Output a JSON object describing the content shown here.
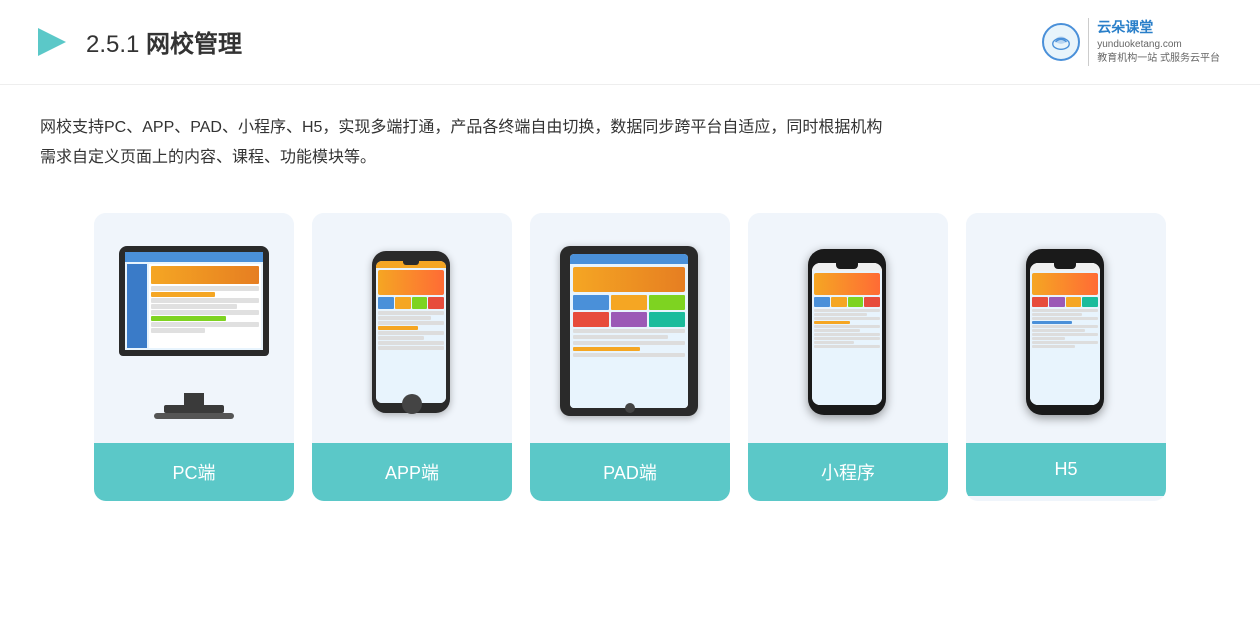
{
  "header": {
    "title_prefix": "2.5.1 ",
    "title_bold": "网校管理",
    "logo_brand": "云朵课堂",
    "logo_domain": "yunduoketang.com",
    "logo_tagline1": "教育机构一站",
    "logo_tagline2": "式服务云平台"
  },
  "description": {
    "line1": "网校支持PC、APP、PAD、小程序、H5，实现多端打通，产品各终端自由切换，数据同步跨平台自适应，同时根据机构",
    "line2": "需求自定义页面上的内容、课程、功能模块等。"
  },
  "cards": [
    {
      "id": "pc",
      "label": "PC端"
    },
    {
      "id": "app",
      "label": "APP端"
    },
    {
      "id": "pad",
      "label": "PAD端"
    },
    {
      "id": "miniapp",
      "label": "小程序"
    },
    {
      "id": "h5",
      "label": "H5"
    }
  ]
}
